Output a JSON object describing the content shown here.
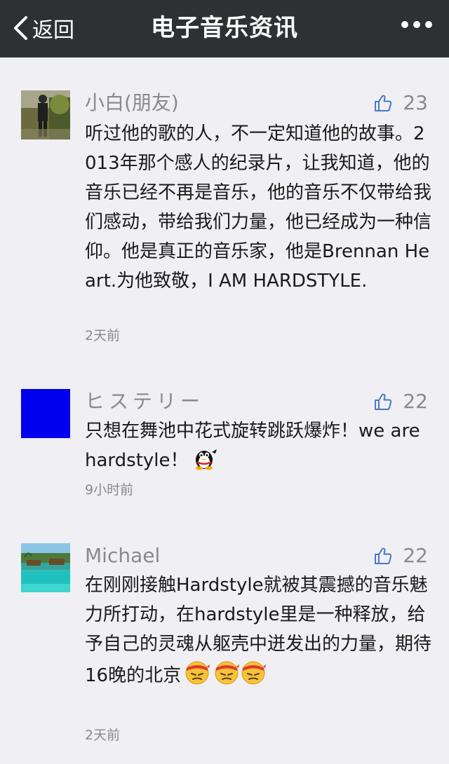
{
  "nav": {
    "back_label": "返回",
    "title": "电子音乐资讯",
    "bg_color": "#2e3033"
  },
  "comments": [
    {
      "user": "小白(朋友)",
      "likes": "23",
      "text": "听过他的歌的人，不一定知道他的故事。2013年那个感人的纪录片，让我知道，他的音乐已经不再是音乐，他的音乐不仅带给我们感动，带给我们力量，他已经成为一种信仰。他是真正的音乐家，他是Brennan Heart.为他致敬，I AM HARDSTYLE.",
      "time": "2天前",
      "avatar_icon": "person-photo-avatar"
    },
    {
      "user": "ヒステリー",
      "likes": "22",
      "text": "只想在舞池中花式旋转跳跃爆炸！we are hardstyle！",
      "time": "9小时前",
      "avatar_icon": "blue-square-avatar",
      "avatar_color": "#0000ee",
      "emoji": "penguin-emoji"
    },
    {
      "user": "Michael",
      "likes": "22",
      "text": "在刚刚接触Hardstyle就被其震撼的音乐魅力所打动，在hardstyle里是一种释放，给予自己的灵魂从躯壳中迸发出的力量，期待16晚的北京",
      "time": "2天前",
      "avatar_icon": "beach-photo-avatar",
      "emoji": "headband-angry-emoji"
    }
  ],
  "colors": {
    "background": "#efeff4",
    "like_icon": "#4a78c2",
    "meta_text": "#8a8a8a"
  }
}
